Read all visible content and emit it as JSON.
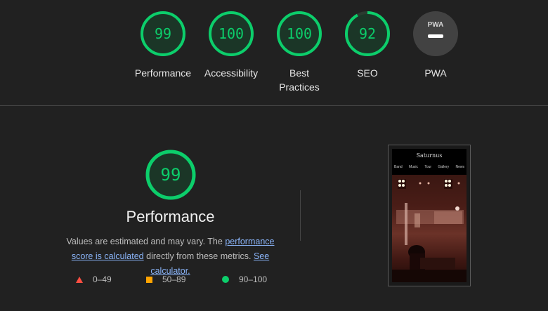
{
  "categories": [
    {
      "score": "99",
      "label": "Performance",
      "fraction": 0.99,
      "color": "#0cce6b"
    },
    {
      "score": "100",
      "label": "Accessibility",
      "fraction": 1.0,
      "color": "#0cce6b"
    },
    {
      "score": "100",
      "label": "Best Practices",
      "fraction": 1.0,
      "color": "#0cce6b"
    },
    {
      "score": "92",
      "label": "SEO",
      "fraction": 0.92,
      "color": "#0cce6b"
    }
  ],
  "pwa": {
    "badge": "PWA",
    "label": "PWA"
  },
  "performance": {
    "score": "99",
    "fraction": 0.99,
    "title": "Performance",
    "desc_part1": "Values are estimated and may vary. The ",
    "desc_link1": "performance score is calculated",
    "desc_part2": " directly from these metrics. ",
    "desc_link2": "See calculator."
  },
  "legend": {
    "fail": "0–49",
    "average": "50–89",
    "pass": "90–100"
  },
  "thumbnail": {
    "logo": "Saturnus",
    "nav": [
      "Band",
      "Music",
      "Tour",
      "Gallery",
      "News"
    ]
  },
  "colors": {
    "pass": "#0cce6b",
    "average": "#ffa400",
    "fail": "#ff4e42",
    "background": "#212121"
  },
  "icons": {
    "fail": "triangle",
    "average": "square",
    "pass": "circle",
    "pwa": "dash"
  }
}
